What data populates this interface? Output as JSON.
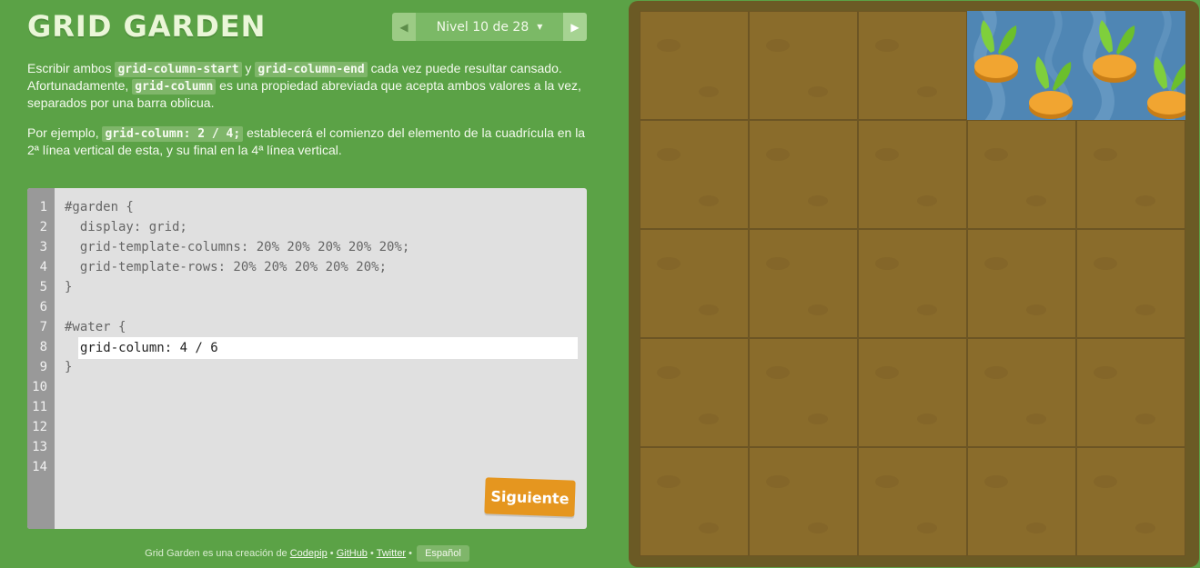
{
  "app": {
    "title": "GRID GARDEN"
  },
  "level_nav": {
    "label": "Nivel 10 de 28",
    "prev_icon": "triangle-left-icon",
    "next_icon": "triangle-right-icon",
    "caret_icon": "caret-down-icon"
  },
  "instructions": {
    "p1": {
      "t1": "Escribir ambos ",
      "c1": "grid-column-start",
      "t2": " y ",
      "c2": "grid-column-end",
      "t3": " cada vez puede resultar cansado. Afortunadamente, ",
      "c3": "grid-column",
      "t4": " es una propiedad abreviada que acepta ambos valores a la vez, separados por una barra oblicua."
    },
    "p2": {
      "t1": "Por ejemplo, ",
      "c1": "grid-column: 2 / 4;",
      "t2": " establecerá el comienzo del elemento de la cuadrícula en la 2ª línea vertical de esta, y su final en la 4ª línea vertical."
    }
  },
  "editor": {
    "line_numbers": [
      "1",
      "2",
      "3",
      "4",
      "5",
      "6",
      "7",
      "8",
      "9",
      "10",
      "11",
      "12",
      "13",
      "14"
    ],
    "lines": {
      "l1": "#garden {",
      "l2": "  display: grid;",
      "l3": "  grid-template-columns: 20% 20% 20% 20% 20%;",
      "l4": "  grid-template-rows: 20% 20% 20% 20% 20%;",
      "l5": "}",
      "l7": "#water {",
      "l9": "}"
    },
    "input_value": "grid-column: 4 / 6",
    "submit_label": "Siguiente"
  },
  "footer": {
    "text": "Grid Garden es una creación de ",
    "link_codepip": "Codepip",
    "sep": " • ",
    "link_github": "GitHub",
    "link_twitter": "Twitter",
    "language": "Español"
  },
  "garden": {
    "water_column_start": 4,
    "water_column_end": 6,
    "water_row_start": 1,
    "water_row_end": 2,
    "plot_icon": "soil-plot-icon",
    "water_icon": "water-icon",
    "carrot_icon": "carrot-icon"
  },
  "colors": {
    "background": "#5ba246",
    "soil": "#8a6c2b",
    "water": "#4f86b4",
    "button": "#e5961f",
    "carrot": "#f1a531",
    "leaf": "#7fcf3c"
  }
}
